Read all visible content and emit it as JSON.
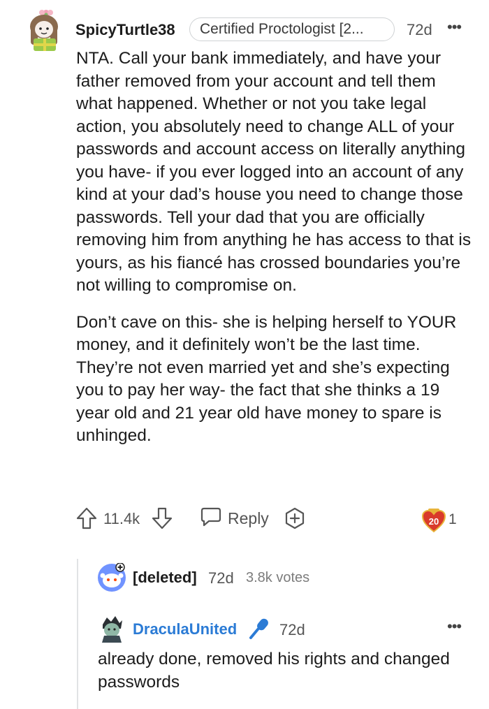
{
  "comment": {
    "username": "SpicyTurtle38",
    "flair": "Certified Proctologist [2...",
    "time": "72d",
    "more": "•••",
    "paragraphs": [
      "NTA. Call your bank immediately, and have your father removed from your account and tell them what happened. Whether or not you take legal action, you absolutely need to change ALL of your passwords and account access on literally anything you have- if you ever logged into an account of any kind at your dad’s house you need to change those passwords. Tell your dad that you are officially removing him from anything he has access to that is yours, as his fiancé has crossed boundaries you’re not willing to compromise on.",
      "Don’t cave on this- she is helping herself to YOUR money, and it definitely won’t be the last time. They’re not even married yet and she’s expecting you to pay her way- the fact that she thinks a 19 year old and 21 year old have money to spare is unhinged."
    ],
    "score": "11.4k",
    "reply_label": "Reply",
    "award_badge_number": "20",
    "award_count": "1"
  },
  "deleted_reply": {
    "username": "[deleted]",
    "time": "72d",
    "votes": "3.8k votes"
  },
  "nested_reply": {
    "username": "DraculaUnited",
    "time": "72d",
    "more": "•••",
    "text": "already done, removed his rights and changed passwords"
  },
  "colors": {
    "username_link": "#2b7bd5",
    "award_red": "#d93a2b",
    "award_gold": "#e8b43a",
    "flair_border": "#cfd2d4",
    "thread_line": "#e1e3e5"
  },
  "icons": {
    "upvote": "arrow-up-outline-icon",
    "downvote": "arrow-down-outline-icon",
    "reply": "speech-bubble-icon",
    "award": "plus-hexagon-icon",
    "award_badge": "heart-20-badge-icon",
    "microphone": "microphone-icon"
  }
}
